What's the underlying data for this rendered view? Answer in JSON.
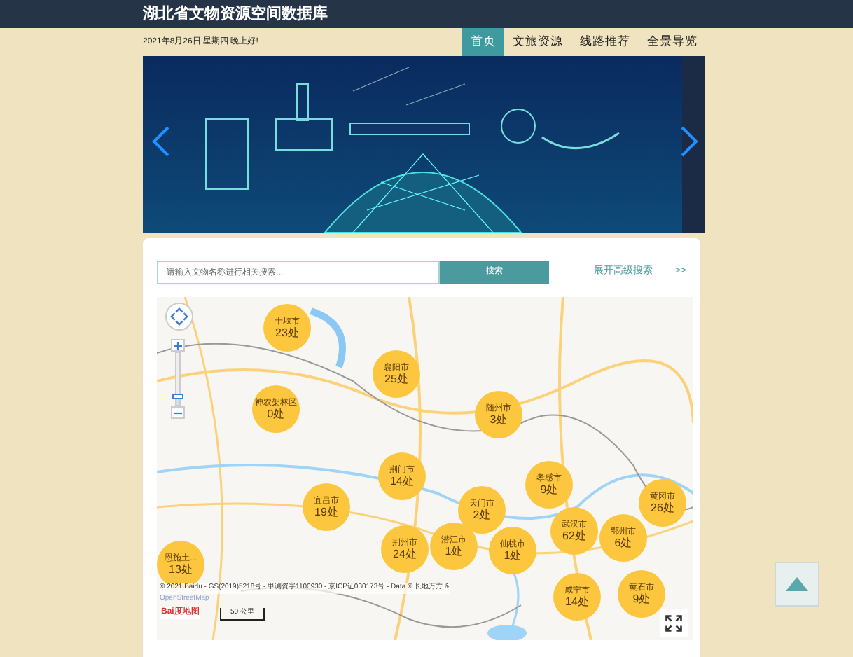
{
  "header": {
    "title": "湖北省文物资源空间数据库",
    "date": "2021年8月26日 星期四 晚上好!"
  },
  "nav": [
    {
      "label": "首页",
      "selected": true
    },
    {
      "label": "文旅资源",
      "selected": false
    },
    {
      "label": "线路推荐",
      "selected": false
    },
    {
      "label": "全景导览",
      "selected": false
    }
  ],
  "search": {
    "placeholder": "请输入文物名称进行相关搜索...",
    "button": "搜索",
    "advanced": "展开高级搜索",
    "advanced_icon": ">>"
  },
  "map": {
    "markers": [
      {
        "name": "十堰市",
        "count": "23处"
      },
      {
        "name": "神农架林区",
        "count": "0处"
      },
      {
        "name": "襄阳市",
        "count": "25处"
      },
      {
        "name": "随州市",
        "count": "3处"
      },
      {
        "name": "荆门市",
        "count": "14处"
      },
      {
        "name": "孝感市",
        "count": "9处"
      },
      {
        "name": "宜昌市",
        "count": "19处"
      },
      {
        "name": "天门市",
        "count": "2处"
      },
      {
        "name": "武汉市",
        "count": "62处"
      },
      {
        "name": "黄冈市",
        "count": "26处"
      },
      {
        "name": "荆州市",
        "count": "24处"
      },
      {
        "name": "潜江市",
        "count": "1处"
      },
      {
        "name": "仙桃市",
        "count": "1处"
      },
      {
        "name": "鄂州市",
        "count": "6处"
      },
      {
        "name": "恩施土...",
        "count": "13处"
      },
      {
        "name": "咸宁市",
        "count": "14处"
      },
      {
        "name": "黄石市",
        "count": "9处"
      }
    ],
    "zoom": {
      "level": 0.15
    },
    "copyright": "© 2021 Baidu - GS(2019)5218号 - 甲测资字1100930 - 京ICP证030173号 - Data © 长地万方 &",
    "osm": "OpenStreetMap",
    "logo": "Bai度地图",
    "scale": "50 公里"
  }
}
